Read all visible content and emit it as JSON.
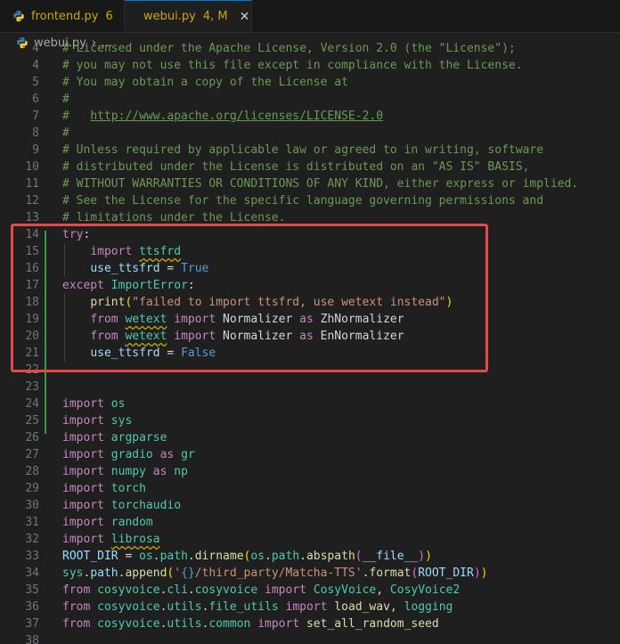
{
  "tabs": [
    {
      "name": "frontend.py",
      "badge": "6",
      "active": false,
      "badge_color": "#cca700"
    },
    {
      "name": "webui.py",
      "badge": "4, M",
      "active": true,
      "badge_color": "#cca700"
    }
  ],
  "breadcrumb": {
    "file": "webui.py",
    "more": "..."
  },
  "colors": {
    "accent": "#0078d4",
    "highlight_box": "#e5484d",
    "git_modified": "#2ea043",
    "warning": "#cca700"
  },
  "lines": [
    {
      "n": "4",
      "tokens": [
        {
          "t": "# Licensed under the Apache License, Version 2.0 (the \"License\");",
          "c": "c-comment"
        }
      ]
    },
    {
      "n": "4",
      "tokens": [
        {
          "t": "# you may not use this file except in compliance with the License.",
          "c": "c-comment"
        }
      ]
    },
    {
      "n": "5",
      "tokens": [
        {
          "t": "# You may obtain a copy of the License at",
          "c": "c-comment"
        }
      ]
    },
    {
      "n": "6",
      "tokens": [
        {
          "t": "#",
          "c": "c-comment"
        }
      ]
    },
    {
      "n": "7",
      "tokens": [
        {
          "t": "#   ",
          "c": "c-comment"
        },
        {
          "t": "http://www.apache.org/licenses/LICENSE-2.0",
          "c": "c-link"
        }
      ]
    },
    {
      "n": "8",
      "tokens": [
        {
          "t": "#",
          "c": "c-comment"
        }
      ]
    },
    {
      "n": "9",
      "tokens": [
        {
          "t": "# Unless required by applicable law or agreed to in writing, software",
          "c": "c-comment"
        }
      ]
    },
    {
      "n": "10",
      "tokens": [
        {
          "t": "# distributed under the License is distributed on an \"AS IS\" BASIS,",
          "c": "c-comment"
        }
      ]
    },
    {
      "n": "11",
      "tokens": [
        {
          "t": "# WITHOUT WARRANTIES OR CONDITIONS OF ANY KIND, either express or implied.",
          "c": "c-comment"
        }
      ]
    },
    {
      "n": "12",
      "tokens": [
        {
          "t": "# See the License for the specific language governing permissions and",
          "c": "c-comment"
        }
      ]
    },
    {
      "n": "13",
      "tokens": [
        {
          "t": "# limitations under the License.",
          "c": "c-comment"
        }
      ]
    },
    {
      "n": "14",
      "tokens": [
        {
          "t": "try",
          "c": "c-kw"
        },
        {
          "t": ":",
          "c": "c-punc"
        }
      ]
    },
    {
      "n": "15",
      "tokens": [
        {
          "t": "    ",
          "c": "c-plain"
        },
        {
          "t": "import",
          "c": "c-kw"
        },
        {
          "t": " ",
          "c": "c-plain"
        },
        {
          "t": "ttsfrd",
          "c": "c-mod squig"
        }
      ]
    },
    {
      "n": "16",
      "tokens": [
        {
          "t": "    ",
          "c": "c-plain"
        },
        {
          "t": "use_ttsfrd",
          "c": "c-var"
        },
        {
          "t": " = ",
          "c": "c-plain"
        },
        {
          "t": "True",
          "c": "c-kw2"
        }
      ]
    },
    {
      "n": "17",
      "tokens": [
        {
          "t": "except",
          "c": "c-kw"
        },
        {
          "t": " ",
          "c": "c-plain"
        },
        {
          "t": "ImportError",
          "c": "c-mod"
        },
        {
          "t": ":",
          "c": "c-punc"
        }
      ]
    },
    {
      "n": "18",
      "tokens": [
        {
          "t": "    ",
          "c": "c-plain"
        },
        {
          "t": "print",
          "c": "c-fn"
        },
        {
          "t": "(",
          "c": "c-br1"
        },
        {
          "t": "\"failed to import ttsfrd, use wetext instead\"",
          "c": "c-str"
        },
        {
          "t": ")",
          "c": "c-br1"
        }
      ]
    },
    {
      "n": "19",
      "tokens": [
        {
          "t": "    ",
          "c": "c-plain"
        },
        {
          "t": "from",
          "c": "c-kw"
        },
        {
          "t": " ",
          "c": "c-plain"
        },
        {
          "t": "wetext",
          "c": "c-mod squig"
        },
        {
          "t": " ",
          "c": "c-plain"
        },
        {
          "t": "import",
          "c": "c-kw"
        },
        {
          "t": " Normalizer ",
          "c": "c-plain"
        },
        {
          "t": "as",
          "c": "c-kw"
        },
        {
          "t": " ZhNormalizer",
          "c": "c-plain"
        }
      ]
    },
    {
      "n": "20",
      "tokens": [
        {
          "t": "    ",
          "c": "c-plain"
        },
        {
          "t": "from",
          "c": "c-kw"
        },
        {
          "t": " ",
          "c": "c-plain"
        },
        {
          "t": "wetext",
          "c": "c-mod squig"
        },
        {
          "t": " ",
          "c": "c-plain"
        },
        {
          "t": "import",
          "c": "c-kw"
        },
        {
          "t": " Normalizer ",
          "c": "c-plain"
        },
        {
          "t": "as",
          "c": "c-kw"
        },
        {
          "t": " EnNormalizer",
          "c": "c-plain"
        }
      ]
    },
    {
      "n": "21",
      "tokens": [
        {
          "t": "    ",
          "c": "c-plain"
        },
        {
          "t": "use_ttsfrd",
          "c": "c-var"
        },
        {
          "t": " = ",
          "c": "c-plain"
        },
        {
          "t": "False",
          "c": "c-kw2"
        }
      ]
    },
    {
      "n": "22",
      "tokens": []
    },
    {
      "n": "23",
      "tokens": []
    },
    {
      "n": "24",
      "tokens": [
        {
          "t": "import",
          "c": "c-kw"
        },
        {
          "t": " ",
          "c": "c-plain"
        },
        {
          "t": "os",
          "c": "c-mod"
        }
      ]
    },
    {
      "n": "25",
      "tokens": [
        {
          "t": "import",
          "c": "c-kw"
        },
        {
          "t": " ",
          "c": "c-plain"
        },
        {
          "t": "sys",
          "c": "c-mod"
        }
      ]
    },
    {
      "n": "26",
      "tokens": [
        {
          "t": "import",
          "c": "c-kw"
        },
        {
          "t": " ",
          "c": "c-plain"
        },
        {
          "t": "argparse",
          "c": "c-mod"
        }
      ]
    },
    {
      "n": "27",
      "tokens": [
        {
          "t": "import",
          "c": "c-kw"
        },
        {
          "t": " ",
          "c": "c-plain"
        },
        {
          "t": "gradio",
          "c": "c-mod"
        },
        {
          "t": " ",
          "c": "c-plain"
        },
        {
          "t": "as",
          "c": "c-kw"
        },
        {
          "t": " ",
          "c": "c-plain"
        },
        {
          "t": "gr",
          "c": "c-mod"
        }
      ]
    },
    {
      "n": "28",
      "tokens": [
        {
          "t": "import",
          "c": "c-kw"
        },
        {
          "t": " ",
          "c": "c-plain"
        },
        {
          "t": "numpy",
          "c": "c-mod"
        },
        {
          "t": " ",
          "c": "c-plain"
        },
        {
          "t": "as",
          "c": "c-kw"
        },
        {
          "t": " ",
          "c": "c-plain"
        },
        {
          "t": "np",
          "c": "c-mod"
        }
      ]
    },
    {
      "n": "29",
      "tokens": [
        {
          "t": "import",
          "c": "c-kw"
        },
        {
          "t": " ",
          "c": "c-plain"
        },
        {
          "t": "torch",
          "c": "c-mod"
        }
      ]
    },
    {
      "n": "30",
      "tokens": [
        {
          "t": "import",
          "c": "c-kw"
        },
        {
          "t": " ",
          "c": "c-plain"
        },
        {
          "t": "torchaudio",
          "c": "c-mod"
        }
      ]
    },
    {
      "n": "31",
      "tokens": [
        {
          "t": "import",
          "c": "c-kw"
        },
        {
          "t": " ",
          "c": "c-plain"
        },
        {
          "t": "random",
          "c": "c-mod"
        }
      ]
    },
    {
      "n": "32",
      "tokens": [
        {
          "t": "import",
          "c": "c-kw"
        },
        {
          "t": " ",
          "c": "c-plain"
        },
        {
          "t": "librosa",
          "c": "c-mod squig"
        }
      ]
    },
    {
      "n": "33",
      "tokens": [
        {
          "t": "ROOT_DIR",
          "c": "c-var"
        },
        {
          "t": " = ",
          "c": "c-plain"
        },
        {
          "t": "os",
          "c": "c-mod"
        },
        {
          "t": ".",
          "c": "c-plain"
        },
        {
          "t": "path",
          "c": "c-mod"
        },
        {
          "t": ".",
          "c": "c-plain"
        },
        {
          "t": "dirname",
          "c": "c-fn"
        },
        {
          "t": "(",
          "c": "c-br1"
        },
        {
          "t": "os",
          "c": "c-mod"
        },
        {
          "t": ".",
          "c": "c-plain"
        },
        {
          "t": "path",
          "c": "c-mod"
        },
        {
          "t": ".",
          "c": "c-plain"
        },
        {
          "t": "abspath",
          "c": "c-fn"
        },
        {
          "t": "(",
          "c": "c-br2"
        },
        {
          "t": "__file__",
          "c": "c-var"
        },
        {
          "t": ")",
          "c": "c-br2"
        },
        {
          "t": ")",
          "c": "c-br1"
        }
      ]
    },
    {
      "n": "34",
      "tokens": [
        {
          "t": "sys",
          "c": "c-mod"
        },
        {
          "t": ".",
          "c": "c-plain"
        },
        {
          "t": "path",
          "c": "c-var"
        },
        {
          "t": ".",
          "c": "c-plain"
        },
        {
          "t": "append",
          "c": "c-fn"
        },
        {
          "t": "(",
          "c": "c-br1"
        },
        {
          "t": "'",
          "c": "c-str"
        },
        {
          "t": "{}",
          "c": "c-kw2"
        },
        {
          "t": "/third_party/Matcha-TTS'",
          "c": "c-str"
        },
        {
          "t": ".",
          "c": "c-plain"
        },
        {
          "t": "format",
          "c": "c-fn"
        },
        {
          "t": "(",
          "c": "c-br2"
        },
        {
          "t": "ROOT_DIR",
          "c": "c-var"
        },
        {
          "t": ")",
          "c": "c-br2"
        },
        {
          "t": ")",
          "c": "c-br1"
        }
      ]
    },
    {
      "n": "35",
      "tokens": [
        {
          "t": "from",
          "c": "c-kw"
        },
        {
          "t": " ",
          "c": "c-plain"
        },
        {
          "t": "cosyvoice",
          "c": "c-mod"
        },
        {
          "t": ".",
          "c": "c-plain"
        },
        {
          "t": "cli",
          "c": "c-mod"
        },
        {
          "t": ".",
          "c": "c-plain"
        },
        {
          "t": "cosyvoice",
          "c": "c-mod"
        },
        {
          "t": " ",
          "c": "c-plain"
        },
        {
          "t": "import",
          "c": "c-kw"
        },
        {
          "t": " ",
          "c": "c-plain"
        },
        {
          "t": "CosyVoice",
          "c": "c-mod"
        },
        {
          "t": ", ",
          "c": "c-plain"
        },
        {
          "t": "CosyVoice2",
          "c": "c-mod"
        }
      ]
    },
    {
      "n": "36",
      "tokens": [
        {
          "t": "from",
          "c": "c-kw"
        },
        {
          "t": " ",
          "c": "c-plain"
        },
        {
          "t": "cosyvoice",
          "c": "c-mod"
        },
        {
          "t": ".",
          "c": "c-plain"
        },
        {
          "t": "utils",
          "c": "c-mod"
        },
        {
          "t": ".",
          "c": "c-plain"
        },
        {
          "t": "file_utils",
          "c": "c-mod"
        },
        {
          "t": " ",
          "c": "c-plain"
        },
        {
          "t": "import",
          "c": "c-kw"
        },
        {
          "t": " ",
          "c": "c-plain"
        },
        {
          "t": "load_wav",
          "c": "c-fn"
        },
        {
          "t": ", ",
          "c": "c-plain"
        },
        {
          "t": "logging",
          "c": "c-mod"
        }
      ]
    },
    {
      "n": "37",
      "tokens": [
        {
          "t": "from",
          "c": "c-kw"
        },
        {
          "t": " ",
          "c": "c-plain"
        },
        {
          "t": "cosyvoice",
          "c": "c-mod"
        },
        {
          "t": ".",
          "c": "c-plain"
        },
        {
          "t": "utils",
          "c": "c-mod"
        },
        {
          "t": ".",
          "c": "c-plain"
        },
        {
          "t": "common",
          "c": "c-mod"
        },
        {
          "t": " ",
          "c": "c-plain"
        },
        {
          "t": "import",
          "c": "c-kw"
        },
        {
          "t": " ",
          "c": "c-plain"
        },
        {
          "t": "set_all_random_seed",
          "c": "c-fn"
        }
      ]
    },
    {
      "n": "38",
      "tokens": []
    }
  ]
}
